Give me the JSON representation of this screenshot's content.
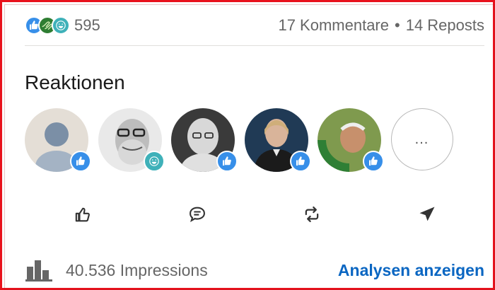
{
  "social_counts": {
    "reaction_icons": [
      "like-icon",
      "support-icon",
      "funny-icon"
    ],
    "reaction_count": "595",
    "comments": "17 Kommentare",
    "separator": "•",
    "reposts": "14 Reposts"
  },
  "reactions_section": {
    "title": "Reaktionen",
    "people": [
      {
        "avatar": "default-avatar",
        "reaction": "like-icon"
      },
      {
        "avatar": "photo-avatar",
        "reaction": "funny-icon"
      },
      {
        "avatar": "photo-avatar",
        "reaction": "like-icon"
      },
      {
        "avatar": "photo-avatar",
        "reaction": "like-icon"
      },
      {
        "avatar": "photo-avatar-opentowork",
        "reaction": "like-icon"
      }
    ],
    "more_label": "..."
  },
  "actions": [
    {
      "name": "like",
      "icon": "thumbs-up-icon"
    },
    {
      "name": "comment",
      "icon": "comment-icon"
    },
    {
      "name": "repost",
      "icon": "repost-icon"
    },
    {
      "name": "send",
      "icon": "send-icon"
    }
  ],
  "impressions": {
    "icon": "bar-chart-icon",
    "text": "40.536 Impressions",
    "analytics_link": "Analysen anzeigen"
  },
  "colors": {
    "frame": "#e8121c",
    "like": "#378fe9",
    "support": "#2e7d32",
    "funny": "#3fb1b9",
    "link": "#0a66c2",
    "muted_text": "#666666"
  }
}
